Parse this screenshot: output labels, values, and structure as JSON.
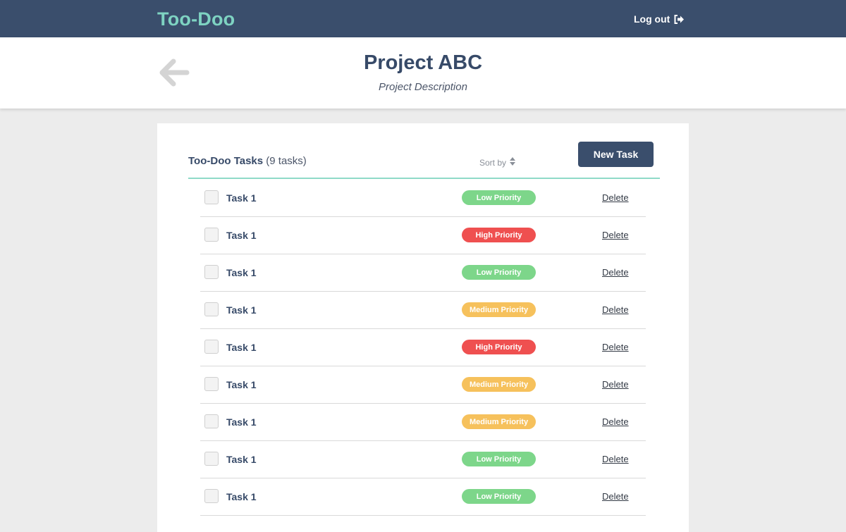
{
  "app": {
    "brand": "Too-Doo",
    "logout_label": "Log out"
  },
  "project": {
    "title": "Project ABC",
    "description": "Project Description"
  },
  "list": {
    "title": "Too-Doo Tasks",
    "count_label": "(9 tasks)",
    "sort_label": "Sort by",
    "new_task_label": "New Task",
    "delete_label": "Delete"
  },
  "priority_colors": {
    "Low Priority": "#7dd68a",
    "High Priority": "#ef5050",
    "Medium Priority": "#f6c15c"
  },
  "tasks": [
    {
      "name": "Task 1",
      "priority": "Low Priority",
      "checked": false
    },
    {
      "name": "Task 1",
      "priority": "High Priority",
      "checked": false
    },
    {
      "name": "Task 1",
      "priority": "Low Priority",
      "checked": false
    },
    {
      "name": "Task 1",
      "priority": "Medium Priority",
      "checked": false
    },
    {
      "name": "Task 1",
      "priority": "High Priority",
      "checked": false
    },
    {
      "name": "Task 1",
      "priority": "Medium Priority",
      "checked": false
    },
    {
      "name": "Task 1",
      "priority": "Medium Priority",
      "checked": false
    },
    {
      "name": "Task 1",
      "priority": "Low Priority",
      "checked": false
    },
    {
      "name": "Task 1",
      "priority": "Low Priority",
      "checked": false
    }
  ]
}
